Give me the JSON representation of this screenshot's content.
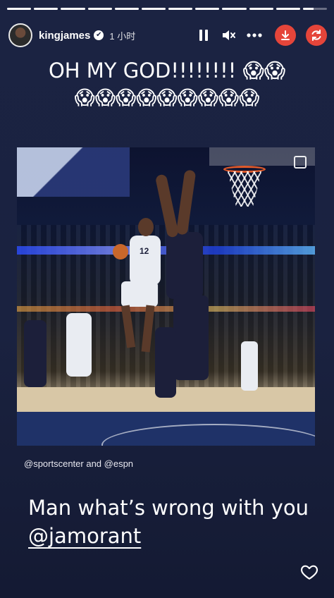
{
  "progress": {
    "segments": [
      1,
      1,
      1,
      1,
      1,
      1,
      1,
      1,
      1,
      1,
      1,
      0.45
    ]
  },
  "header": {
    "username": "kingjames",
    "verified_mark": "✔",
    "time": "1 小时",
    "icons": [
      "pause-icon",
      "mute-icon",
      "more-icon",
      "download-icon",
      "repost-icon"
    ]
  },
  "caption_top": {
    "line1": "OH MY GOD!!!!!!!! 😱😱",
    "line2": "😱😱😱😱😱😱😱😱😱"
  },
  "video": {
    "jersey_number": "12"
  },
  "credits": "@sportscenter and @espn",
  "caption_bottom": {
    "text": "Man what’s wrong with you ",
    "mention": "@jamorant"
  },
  "colors": {
    "background": "#1b2342",
    "action_red": "#e5453a"
  }
}
